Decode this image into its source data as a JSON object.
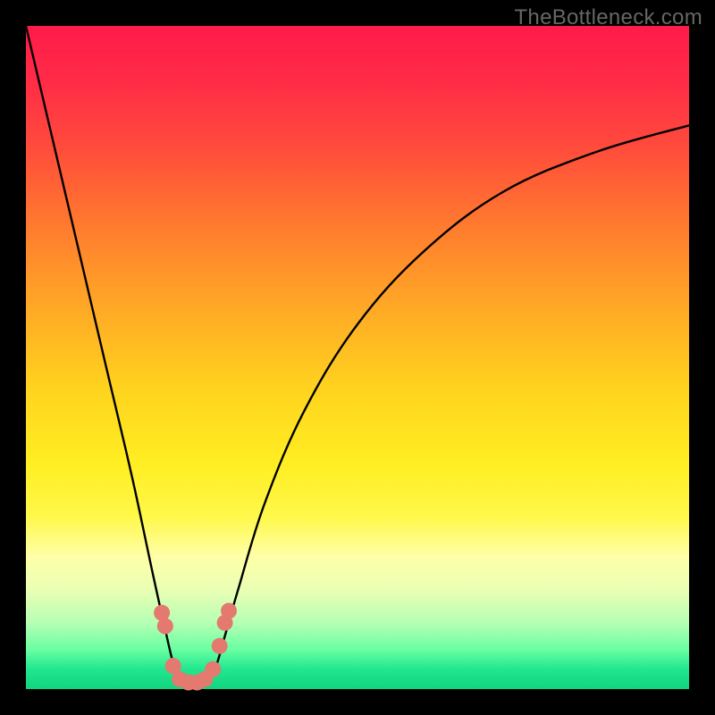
{
  "watermark": "TheBottleneck.com",
  "chart_data": {
    "type": "line",
    "title": "",
    "xlabel": "",
    "ylabel": "",
    "curve": {
      "note": "Decorative V-shaped curve with no labeled numeric axes; x normalized 0..1 across plot width; y normalized 0..1 from bottom (0) to top (1).",
      "x": [
        0.0,
        0.04,
        0.08,
        0.12,
        0.16,
        0.19,
        0.21,
        0.225,
        0.24,
        0.255,
        0.27,
        0.285,
        0.3,
        0.32,
        0.36,
        0.42,
        0.5,
        0.6,
        0.72,
        0.86,
        1.0
      ],
      "y": [
        1.0,
        0.83,
        0.66,
        0.49,
        0.32,
        0.18,
        0.09,
        0.03,
        0.01,
        0.005,
        0.01,
        0.03,
        0.08,
        0.15,
        0.28,
        0.42,
        0.55,
        0.66,
        0.75,
        0.81,
        0.85
      ]
    },
    "markers": {
      "shape": "circle",
      "color": "#e4796f",
      "points_xy_norm": [
        [
          0.205,
          0.115
        ],
        [
          0.21,
          0.095
        ],
        [
          0.222,
          0.035
        ],
        [
          0.232,
          0.015
        ],
        [
          0.245,
          0.01
        ],
        [
          0.258,
          0.01
        ],
        [
          0.27,
          0.015
        ],
        [
          0.282,
          0.03
        ],
        [
          0.292,
          0.065
        ],
        [
          0.3,
          0.1
        ],
        [
          0.306,
          0.118
        ]
      ]
    },
    "background_gradient": {
      "top": "#ff1a4a",
      "bottom": "#12d47e"
    }
  }
}
